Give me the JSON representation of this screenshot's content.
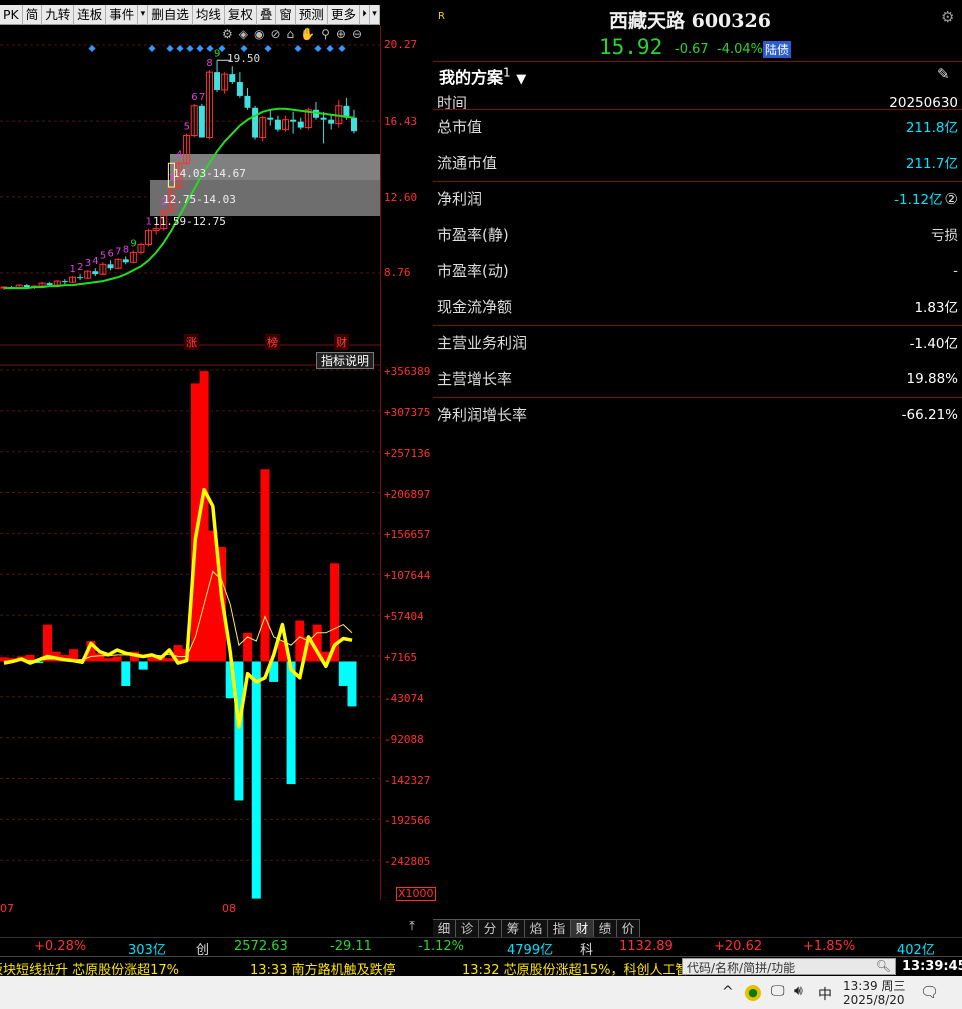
{
  "toolbar": {
    "items": [
      "PK",
      "简",
      "九转",
      "连板",
      "事件",
      "▾",
      "删自选",
      "均线",
      "复权",
      "叠",
      "窗",
      "预测",
      "更多",
      "⏵",
      "▾"
    ]
  },
  "stock": {
    "name": "西藏天路 600326",
    "flag": "R",
    "price": "15.92",
    "change": "-0.67",
    "change_pct": "-4.04%",
    "tag": "陆债"
  },
  "plan": {
    "title": "我的方案",
    "suffix": "1"
  },
  "fundamentals": [
    {
      "label": "时间",
      "value": "20250630",
      "color": "#ffffff"
    },
    {
      "label": "总市值",
      "value": "211.8亿",
      "color": "#00e5ff"
    },
    {
      "label": "流通市值",
      "value": "211.7亿",
      "color": "#00e5ff"
    },
    {
      "label": "净利润",
      "value": "-1.12亿",
      "color": "#00e5ff",
      "icon": "②"
    },
    {
      "label": "市盈率(静)",
      "value": "亏损",
      "color": "#dddddd"
    },
    {
      "label": "市盈率(动)",
      "value": "-",
      "color": "#dddddd"
    },
    {
      "label": "现金流净额",
      "value": "1.83亿",
      "color": "#ffffff"
    },
    {
      "label": "主营业务利润",
      "value": "-1.40亿",
      "color": "#ffffff"
    },
    {
      "label": "主营增长率",
      "value": "19.88%",
      "color": "#ffffff"
    },
    {
      "label": "净利润增长率",
      "value": "-66.21%",
      "color": "#ffffff"
    }
  ],
  "price_axis": [
    "20.27",
    "16.43",
    "12.60",
    "8.76"
  ],
  "price_annotations": {
    "high": "19.50",
    "zone1": "14.03-14.67",
    "zone2": "12.75-14.03",
    "zone3": "11.59-12.75"
  },
  "event_markers": [
    "涨",
    "榜",
    "财"
  ],
  "indicator_button": "指标说明",
  "indicator_axis": [
    "+356389",
    "+307375",
    "+257136",
    "+206897",
    "+156657",
    "+107644",
    "+57404",
    "+7165",
    "-43074",
    "-92088",
    "-142327",
    "-192566",
    "-242805"
  ],
  "indicator_multiplier": "X1000",
  "date_labels": [
    "07",
    "08"
  ],
  "bottom_tabs": [
    "细",
    "诊",
    "分",
    "筹",
    "焰",
    "指",
    "财",
    "绩",
    "价"
  ],
  "index_bar": {
    "pct1": "+0.28%",
    "amt1": "303亿",
    "name2": "创",
    "val2": "2572.63",
    "chg2": "-29.11",
    "pct2": "-1.12%",
    "amt2": "4799亿",
    "name3": "科",
    "val3": "1132.89",
    "chg3": "+20.62",
    "pct3": "+1.85%",
    "amt3": "402亿"
  },
  "news": {
    "item1": "板块短线拉升 芯原股份涨超17%",
    "item2": "13:33 南方路机触及跌停",
    "item3": "13:32 芯原股份涨超15%，科创人工智",
    "search_placeholder": "代码/名称/简拼/功能",
    "clock": "13:39:45"
  },
  "taskbar": {
    "time": "13:39 周三",
    "date": "2025/8/20",
    "ime": "中"
  },
  "chart_data": [
    {
      "type": "candlestick",
      "title": "",
      "y_ticks": [
        20.27,
        16.43,
        12.6,
        8.76
      ],
      "candles": [
        [
          8.0,
          8.1,
          7.9,
          8.05
        ],
        [
          8.05,
          8.1,
          7.95,
          8.0
        ],
        [
          8.0,
          8.2,
          7.95,
          8.15
        ],
        [
          8.15,
          8.2,
          8.0,
          8.05
        ],
        [
          8.05,
          8.15,
          7.95,
          8.1
        ],
        [
          8.1,
          8.3,
          8.05,
          8.25
        ],
        [
          8.25,
          8.3,
          8.1,
          8.15
        ],
        [
          8.15,
          8.4,
          8.1,
          8.35
        ],
        [
          8.35,
          8.45,
          8.2,
          8.3
        ],
        [
          8.3,
          8.6,
          8.25,
          8.55
        ],
        [
          8.55,
          8.7,
          8.4,
          8.5
        ],
        [
          8.5,
          8.9,
          8.45,
          8.85
        ],
        [
          8.85,
          9.0,
          8.6,
          8.7
        ],
        [
          8.7,
          9.3,
          8.65,
          9.2
        ],
        [
          9.2,
          9.4,
          8.9,
          9.0
        ],
        [
          9.0,
          9.5,
          8.95,
          9.45
        ],
        [
          9.45,
          9.6,
          9.2,
          9.3
        ],
        [
          9.3,
          9.9,
          9.25,
          9.8
        ],
        [
          9.8,
          10.3,
          9.7,
          10.2
        ],
        [
          10.2,
          11.0,
          10.1,
          10.9
        ],
        [
          10.9,
          11.2,
          10.7,
          11.0
        ],
        [
          11.0,
          12.0,
          10.9,
          11.9
        ],
        [
          11.9,
          13.2,
          11.8,
          13.1
        ],
        [
          13.1,
          14.4,
          13.0,
          14.3
        ],
        [
          14.3,
          15.8,
          14.2,
          15.7
        ],
        [
          15.7,
          17.3,
          15.6,
          17.2
        ],
        [
          17.2,
          17.3,
          15.6,
          15.6
        ],
        [
          15.6,
          19.0,
          15.5,
          18.9
        ],
        [
          18.9,
          19.5,
          17.9,
          18.0
        ],
        [
          18.0,
          18.9,
          17.8,
          18.8
        ],
        [
          18.8,
          19.2,
          18.3,
          18.4
        ],
        [
          18.4,
          18.9,
          17.6,
          17.7
        ],
        [
          17.7,
          18.1,
          17.0,
          17.1
        ],
        [
          17.1,
          17.2,
          15.5,
          15.6
        ],
        [
          15.6,
          16.7,
          15.4,
          16.6
        ],
        [
          16.6,
          17.0,
          16.2,
          16.5
        ],
        [
          16.5,
          16.7,
          15.9,
          16.0
        ],
        [
          16.0,
          16.7,
          15.9,
          16.5
        ],
        [
          16.5,
          16.9,
          15.8,
          16.4
        ],
        [
          16.4,
          16.6,
          16.0,
          16.1
        ],
        [
          16.1,
          17.1,
          16.0,
          17.0
        ],
        [
          17.0,
          17.4,
          16.5,
          16.6
        ],
        [
          16.6,
          16.9,
          15.3,
          16.5
        ],
        [
          16.5,
          16.8,
          16.0,
          16.3
        ],
        [
          16.3,
          17.5,
          16.1,
          17.2
        ],
        [
          17.2,
          17.6,
          16.5,
          16.6
        ],
        [
          16.6,
          17.0,
          15.8,
          15.92
        ]
      ],
      "ma": [
        8.0,
        8.0,
        8.0,
        8.0,
        8.05,
        8.05,
        8.1,
        8.1,
        8.15,
        8.15,
        8.2,
        8.25,
        8.3,
        8.35,
        8.45,
        8.55,
        8.7,
        8.9,
        9.1,
        9.4,
        9.8,
        10.3,
        10.9,
        11.6,
        12.3,
        13.0,
        13.7,
        14.3,
        14.9,
        15.4,
        15.8,
        16.2,
        16.5,
        16.7,
        16.9,
        17.0,
        17.05,
        17.05,
        17.0,
        16.95,
        16.9,
        16.85,
        16.8,
        16.75,
        16.7,
        16.65,
        16.6
      ]
    },
    {
      "type": "bar",
      "title": "",
      "y_ticks": [
        356389,
        307375,
        257136,
        206897,
        156657,
        107644,
        57404,
        7165,
        -43074,
        -92088,
        -142327,
        -192566,
        -242805
      ],
      "values": [
        5000,
        4000,
        6000,
        8000,
        -2000,
        45000,
        12000,
        8000,
        15000,
        3000,
        25000,
        10000,
        4000,
        6000,
        -30000,
        12000,
        -10000,
        8000,
        6000,
        4000,
        20000,
        15000,
        340000,
        355000,
        160000,
        140000,
        -45000,
        -170000,
        35000,
        -290000,
        235000,
        -25000,
        25000,
        -150000,
        50000,
        30000,
        45000,
        12000,
        120000,
        -30000,
        -55000
      ],
      "line_yellow": [
        -2000,
        0,
        3000,
        -2000,
        2000,
        6000,
        4000,
        2000,
        1000,
        -1000,
        22000,
        12000,
        8000,
        14000,
        10000,
        8000,
        6000,
        8000,
        4000,
        14000,
        -2000,
        1000,
        150000,
        210000,
        190000,
        80000,
        12000,
        -80000,
        -15000,
        -25000,
        -20000,
        8000,
        45000,
        -10000,
        -20000,
        30000,
        12000,
        -6000,
        20000,
        28000,
        26000
      ],
      "line_thin": [
        0,
        1000,
        2000,
        1000,
        1000,
        3000,
        3000,
        3000,
        2000,
        2000,
        6000,
        7000,
        7000,
        8000,
        8000,
        8000,
        7000,
        8000,
        7000,
        9000,
        6000,
        6000,
        30000,
        70000,
        110000,
        100000,
        70000,
        20000,
        30000,
        25000,
        55000,
        30000,
        25000,
        20000,
        30000,
        25000,
        35000,
        35000,
        40000,
        45000,
        35000
      ]
    }
  ]
}
